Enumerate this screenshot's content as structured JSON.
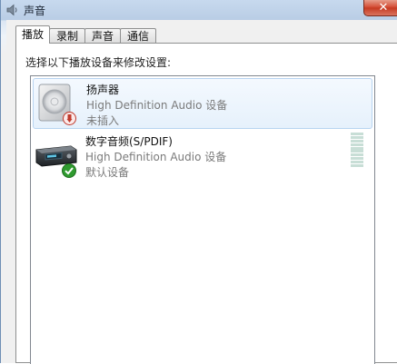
{
  "window": {
    "title": "声音",
    "close_glyph": "✕"
  },
  "tabs": [
    {
      "label": "播放",
      "active": true
    },
    {
      "label": "录制",
      "active": false
    },
    {
      "label": "声音",
      "active": false
    },
    {
      "label": "通信",
      "active": false
    }
  ],
  "playback": {
    "instruction": "选择以下播放设备来修改设置:",
    "devices": [
      {
        "name": "扬声器",
        "description": "High Definition Audio 设备",
        "status": "未插入",
        "icon": "speaker-icon",
        "badge": "unplugged-badge-icon",
        "selected": true
      },
      {
        "name": "数字音频(S/PDIF)",
        "description": "High Definition Audio 设备",
        "status": "默认设备",
        "icon": "spdif-device-icon",
        "badge": "default-checkmark-icon",
        "selected": false
      }
    ]
  },
  "colors": {
    "selection_bg": "#e6f1fc",
    "selection_border": "#b7d4f1",
    "secondary_text": "#7a7a7a",
    "close_button": "#c63b23",
    "default_check": "#2f9b2f",
    "unplugged_badge": "#c0392b"
  }
}
